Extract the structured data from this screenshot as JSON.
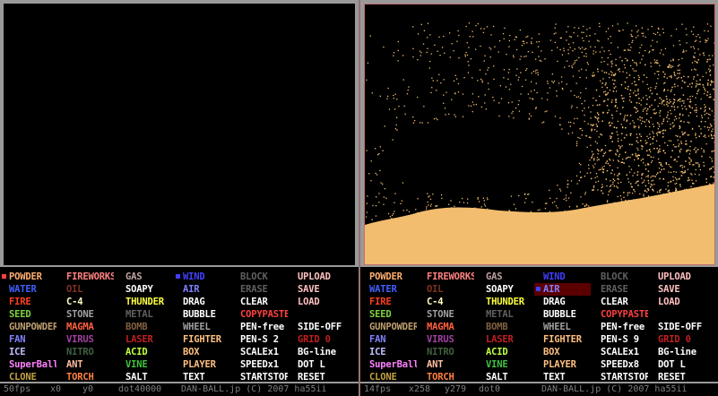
{
  "colors": {
    "sand": "#f2bd6e",
    "menu_bg": "#000000",
    "frame": "#9a9a9a"
  },
  "columns": [
    [
      {
        "label": "POWDER",
        "color": "#ffb070"
      },
      {
        "label": "WATER",
        "color": "#4060ff"
      },
      {
        "label": "FIRE",
        "color": "#ff4020"
      },
      {
        "label": "SEED",
        "color": "#80d040"
      },
      {
        "label": "GUNPOWDER",
        "color": "#c0a070"
      },
      {
        "label": "FAN",
        "color": "#8080ff"
      },
      {
        "label": "ICE",
        "color": "#c0c0ff"
      },
      {
        "label": "SuperBall",
        "color": "#ff80ff"
      },
      {
        "label": "CLONE",
        "color": "#c0a040"
      }
    ],
    [
      {
        "label": "FIREWORKS",
        "color": "#ff8080"
      },
      {
        "label": "OIL",
        "color": "#803020"
      },
      {
        "label": "C-4",
        "color": "#ffffc0"
      },
      {
        "label": "STONE",
        "color": "#a0a0a0"
      },
      {
        "label": "MAGMA",
        "color": "#ff6040"
      },
      {
        "label": "VIRUS",
        "color": "#a040a0"
      },
      {
        "label": "NITRO",
        "color": "#406040"
      },
      {
        "label": "ANT",
        "color": "#ffc0a0"
      },
      {
        "label": "TORCH",
        "color": "#ff8040"
      }
    ],
    [
      {
        "label": "GAS",
        "color": "#c0a0a0"
      },
      {
        "label": "SOAPY",
        "color": "#ffffff"
      },
      {
        "label": "THUNDER",
        "color": "#ffff40"
      },
      {
        "label": "METAL",
        "color": "#606060"
      },
      {
        "label": "BOMB",
        "color": "#806040"
      },
      {
        "label": "LASER",
        "color": "#c02020"
      },
      {
        "label": "ACID",
        "color": "#c0ff40"
      },
      {
        "label": "VINE",
        "color": "#40c040"
      },
      {
        "label": "SALT",
        "color": "#ffffff"
      }
    ],
    [
      {
        "label": "WIND",
        "color": "#4040ff"
      },
      {
        "label": "AIR",
        "color": "#8080ff"
      },
      {
        "label": "DRAG",
        "color": "#ffffff"
      },
      {
        "label": "BUBBLE",
        "color": "#ffffff"
      },
      {
        "label": "WHEEL",
        "color": "#a0a0a0"
      },
      {
        "label": "FIGHTER",
        "color": "#ffc080"
      },
      {
        "label": "BOX",
        "color": "#ffc080"
      },
      {
        "label": "PLAYER",
        "color": "#ffc080"
      },
      {
        "label": "TEXT",
        "color": "#ffffff"
      }
    ],
    [
      {
        "label": "BLOCK",
        "color": "#606060"
      },
      {
        "label": "ERASE",
        "color": "#606060"
      },
      {
        "label": "CLEAR",
        "color": "#ffffff"
      },
      {
        "label": "COPYPASTE",
        "color": "#ff4040"
      },
      {
        "label": "PEN-free",
        "color": "#ffffff"
      },
      {
        "label": "PEN-S 2",
        "color": "#ffffff"
      },
      {
        "label": "SCALEx1",
        "color": "#ffffff"
      },
      {
        "label": "SPEEDx1",
        "color": "#ffffff"
      },
      {
        "label": "STARTSTOP",
        "color": "#ffffff"
      }
    ],
    [
      {
        "label": "UPLOAD",
        "color": "#ffc0c0"
      },
      {
        "label": "SAVE",
        "color": "#ffc0c0"
      },
      {
        "label": "LOAD",
        "color": "#ffc0c0"
      },
      {
        "label": "",
        "color": "#ffffff"
      },
      {
        "label": "SIDE-OFF",
        "color": "#ffffff"
      },
      {
        "label": "GRID 0",
        "color": "#c02020"
      },
      {
        "label": "BG-line",
        "color": "#ffffff"
      },
      {
        "label": "DOT L",
        "color": "#ffffff"
      },
      {
        "label": "RESET",
        "color": "#ffffff"
      }
    ]
  ],
  "right_overrides": {
    "pen_size": "PEN-S 9",
    "grid": "GRID 0",
    "speed": "SPEEDx8"
  },
  "left_status": {
    "fps": "50fps",
    "x": "x0",
    "y": "y0",
    "dot": "dot40000",
    "credit": "DAN-BALL.jp (C) 2007 ha55ii"
  },
  "right_status": {
    "fps": "14fps",
    "x": "x258",
    "y": "y279",
    "dot": "dot0",
    "credit": "DAN-BALL.jp (C) 2007 ha55ii"
  },
  "left_selected": "POWDER",
  "right_selected": "AIR"
}
